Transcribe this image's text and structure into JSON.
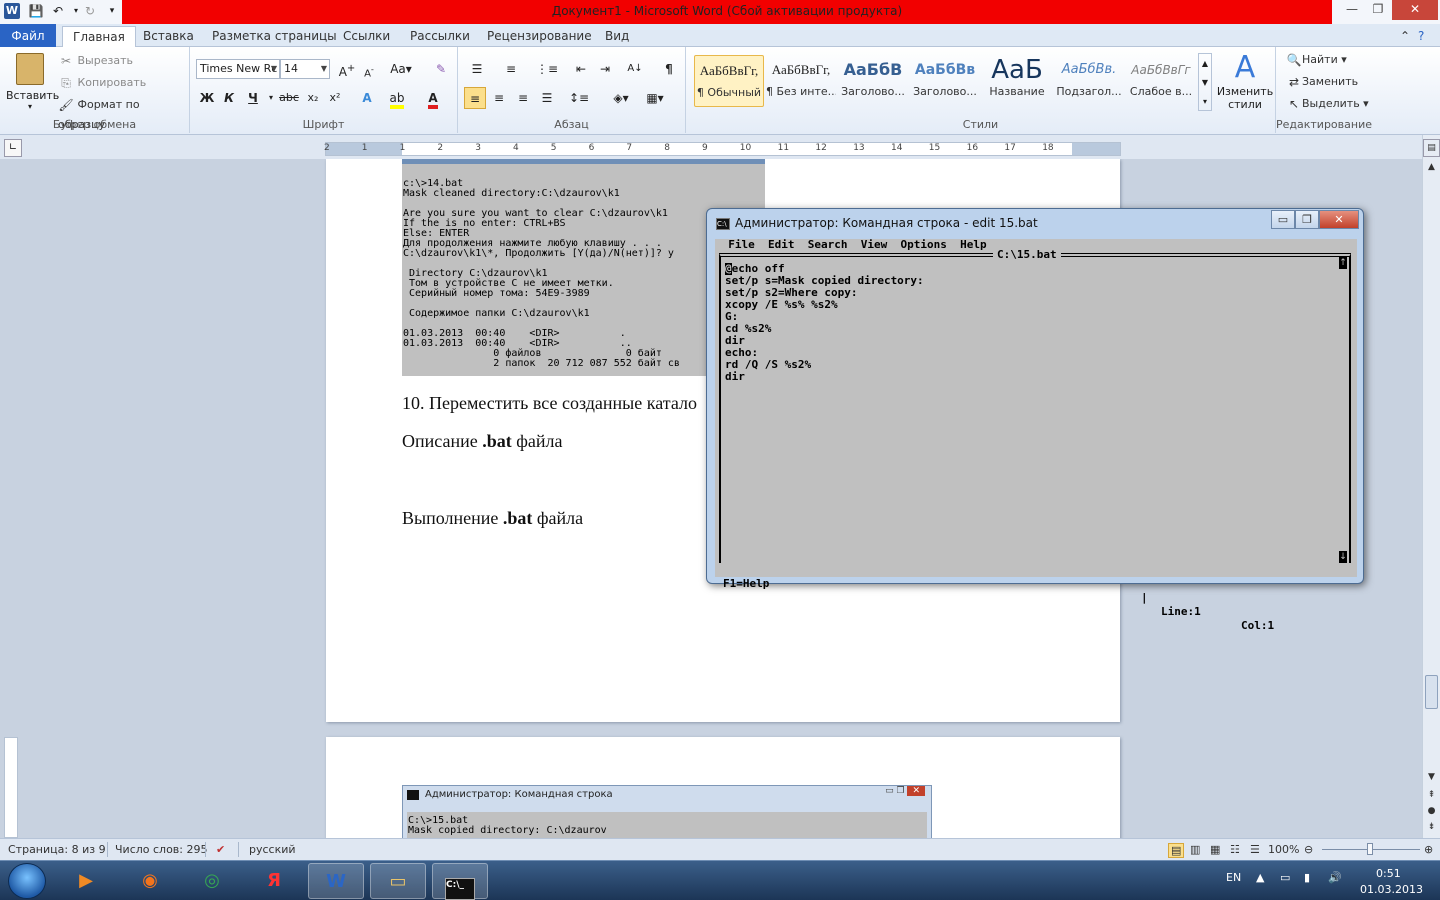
{
  "window": {
    "title": "Документ1  -  Microsoft Word (Сбой активации продукта)"
  },
  "ribbon": {
    "tabs": [
      "Файл",
      "Главная",
      "Вставка",
      "Разметка страницы",
      "Ссылки",
      "Рассылки",
      "Рецензирование",
      "Вид"
    ],
    "clipboard": {
      "paste": "Вставить",
      "cut": "Вырезать",
      "copy": "Копировать",
      "format_painter": "Формат по образцу",
      "label": "Буфер обмена"
    },
    "font": {
      "family": "Times New Rc",
      "size": "14",
      "label": "Шрифт"
    },
    "paragraph": {
      "label": "Абзац"
    },
    "styles": {
      "label": "Стили",
      "items": [
        {
          "sample": "АаБбВвГг,",
          "name": "¶ Обычный"
        },
        {
          "sample": "АаБбВвГг,",
          "name": "¶ Без инте..."
        },
        {
          "sample": "АаБбВ",
          "name": "Заголово..."
        },
        {
          "sample": "АаБбВв",
          "name": "Заголово..."
        },
        {
          "sample": "АаБ",
          "name": "Название"
        },
        {
          "sample": "АаБбВв.",
          "name": "Подзагол..."
        },
        {
          "sample": "АаБбВвГг",
          "name": "Слабое в..."
        }
      ],
      "change_styles": "Изменить стили"
    },
    "editing": {
      "find": "Найти",
      "replace": "Заменить",
      "select": "Выделить",
      "label": "Редактирование"
    }
  },
  "ruler": {
    "numbers": [
      "2",
      "1",
      "1",
      "2",
      "3",
      "4",
      "5",
      "6",
      "7",
      "8",
      "9",
      "10",
      "11",
      "12",
      "13",
      "14",
      "15",
      "16",
      "17",
      "18"
    ]
  },
  "document": {
    "top_shot_lines": [
      "c:\\>14.bat",
      "Mask cleaned directory:C:\\dzaurov\\k1",
      "",
      "Are you sure you want to clear C:\\dzaurov\\k1",
      "If the is no enter: CTRL+BS",
      "Else: ENTER",
      "Для продолжения нажмите любую клавишу . . .",
      "C:\\dzaurov\\k1\\*, Продолжить [Y(да)/N(нет)]? y",
      "",
      " Directory C:\\dzaurov\\k1",
      " Том в устройстве C не имеет метки.",
      " Серийный номер тома: 54E9-3989",
      "",
      " Содержимое папки C:\\dzaurov\\k1",
      "",
      "01.03.2013  00:40    <DIR>          .",
      "01.03.2013  00:40    <DIR>          ..",
      "               0 файлов              0 байт",
      "               2 папок  20 712 087 552 байт св"
    ],
    "item10": "10. Переместить все созданные катало",
    "desc_prefix": "Описание ",
    "desc_bold": ".bat",
    "desc_suffix": " файла",
    "exec_prefix": "Выполнение ",
    "exec_bold": ".bat",
    "exec_suffix": " файла",
    "bottom_shot": {
      "title": "Администратор: Командная строка",
      "lines": [
        "C:\\>15.bat",
        "Mask copied directory: C:\\dzaurov"
      ]
    }
  },
  "edit_window": {
    "title": "Администратор: Командная строка - edit  15.bat",
    "menu": [
      "File",
      "Edit",
      "Search",
      "View",
      "Options",
      "Help"
    ],
    "filename": "C:\\15.bat",
    "cursor_char": "@",
    "lines": [
      "echo off",
      "set/p s=Mask copied directory:",
      "set/p s2=Where copy:",
      "xcopy /E %s% %s2%",
      "G:",
      "cd %s2%",
      "dir",
      "echo:",
      "rd /Q /S %s2%",
      "dir"
    ],
    "help": "F1=Help",
    "line": "Line:1",
    "col": "Col:1"
  },
  "statusbar": {
    "page": "Страница: 8 из 9",
    "words": "Число слов: 295",
    "language": "русский",
    "zoom": "100%"
  },
  "taskbar": {
    "language": "EN",
    "time": "0:51",
    "date": "01.03.2013"
  }
}
